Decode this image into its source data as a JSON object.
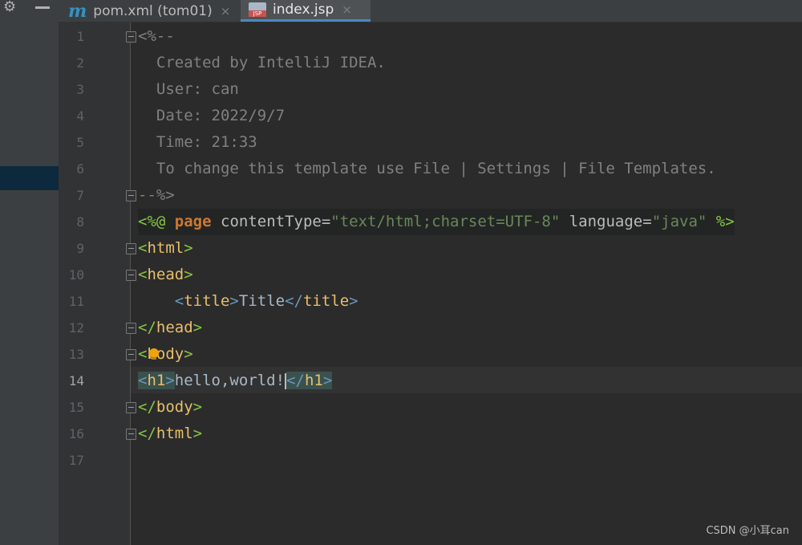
{
  "tabs": [
    {
      "label": "pom.xml (tom01)",
      "icon": "maven-m-icon",
      "active": false
    },
    {
      "label": "index.jsp",
      "icon": "jsp-file-icon",
      "active": true
    }
  ],
  "jsp_badge": "JSP",
  "maven_glyph": "m",
  "close_glyph": "×",
  "gutter": {
    "line_numbers": [
      "1",
      "2",
      "3",
      "4",
      "5",
      "6",
      "7",
      "8",
      "9",
      "10",
      "11",
      "12",
      "13",
      "14",
      "15",
      "16",
      "17"
    ],
    "current_line": "14"
  },
  "code": {
    "l1": "<%--",
    "l2": "  Created by IntelliJ IDEA.",
    "l3": "  User: can",
    "l4": "  Date: 2022/9/7",
    "l5": "  Time: 21:33",
    "l6": "  To change this template use File | Settings | File Templates.",
    "l7": "--%>",
    "l8": {
      "open": "<%@",
      "kw": "page",
      "a1": "contentType",
      "eq": "=",
      "v1": "\"text/html;charset=UTF-8\"",
      "a2": "language",
      "v2": "\"java\"",
      "close": "%>"
    },
    "l9": {
      "lt": "<",
      "name": "html",
      "gt": ">"
    },
    "l10": {
      "lt": "<",
      "name": "head",
      "gt": ">"
    },
    "l11": {
      "lt": "<",
      "name": "title",
      "gt": ">",
      "text": "Title",
      "clt": "</",
      "cname": "title",
      "cgt": ">"
    },
    "l12": {
      "lt": "</",
      "name": "head",
      "gt": ">"
    },
    "l13": {
      "lt": "<",
      "name": "body",
      "gt": ">"
    },
    "l14": {
      "lt": "<",
      "name": "h1",
      "gt": ">",
      "text": "hello,world!",
      "clt": "</",
      "cname": "h1",
      "cgt": ">"
    },
    "l15": {
      "lt": "</",
      "name": "body",
      "gt": ">"
    },
    "l16": {
      "lt": "</",
      "name": "html",
      "gt": ">"
    }
  },
  "watermark": "CSDN @小耳can",
  "colors": {
    "comment": "#808080",
    "tag": "#e8bf6a",
    "keyword": "#cc7832",
    "string": "#6a8759",
    "accent": "#4a88c7"
  }
}
